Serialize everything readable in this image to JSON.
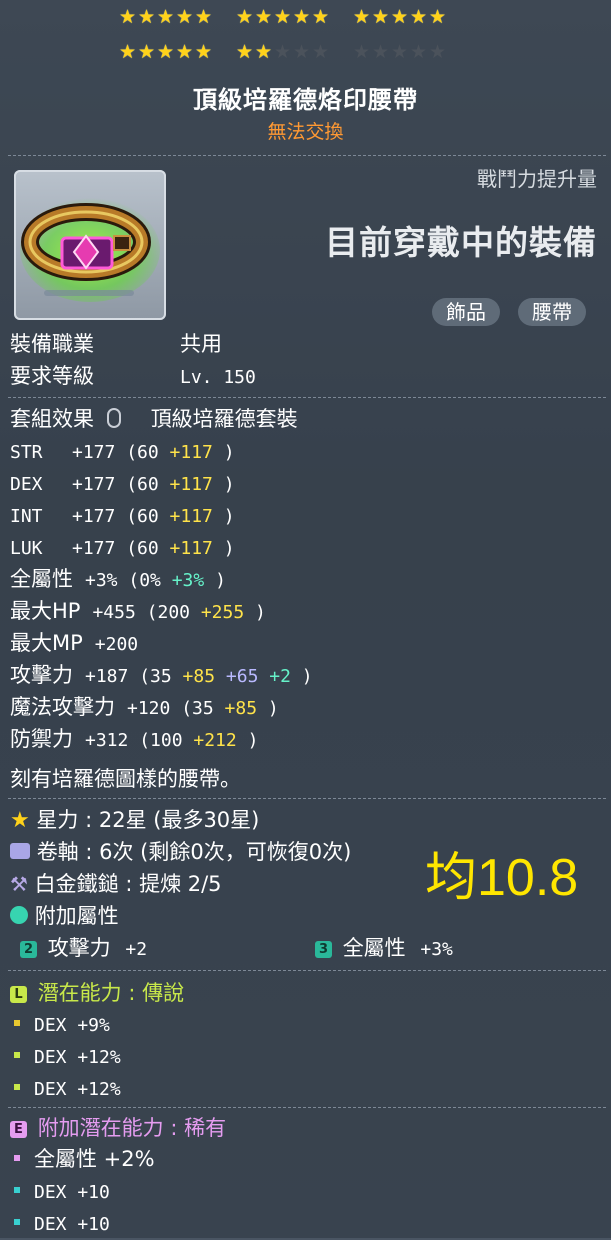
{
  "stars": {
    "filled": 22,
    "total": 30,
    "icon": "star-icon",
    "on_color": "#ffd21a",
    "off_color": "#4b525b"
  },
  "item": {
    "name": "頂級培羅德烙印腰帶",
    "trade_status": "無法交換",
    "trade_color": "#ff9933"
  },
  "compare": {
    "label": "戰鬥力提升量",
    "current_equipped": "目前穿戴中的裝備"
  },
  "tags": [
    "飾品",
    "腰帶"
  ],
  "requirements": [
    {
      "label": "裝備職業",
      "value": "共用"
    },
    {
      "label": "要求等級",
      "value": "Lv. 150"
    }
  ],
  "set_effect": {
    "label": "套組效果",
    "value": "頂級培羅德套裝"
  },
  "stats": [
    {
      "label": "STR",
      "total": "+177",
      "base": "(60 ",
      "b1": "+117",
      "close": ")"
    },
    {
      "label": "DEX",
      "total": "+177",
      "base": "(60 ",
      "b1": "+117",
      "close": ")"
    },
    {
      "label": "INT",
      "total": "+177",
      "base": "(60 ",
      "b1": "+117",
      "close": ")"
    },
    {
      "label": "LUK",
      "total": "+177",
      "base": "(60 ",
      "b1": "+117",
      "close": ")"
    },
    {
      "label": "全屬性",
      "total": "+3%",
      "base": "(0% ",
      "b1": "+3%",
      "close": ")"
    },
    {
      "label": "最大HP",
      "total": "+455",
      "base": "(200 ",
      "b1": "+255",
      "close": ")"
    },
    {
      "label": "最大MP",
      "total": "+200"
    },
    {
      "label": "攻擊力",
      "total": "+187",
      "base": "(35 ",
      "b1": "+85",
      "b2": "+65",
      "b3": "+2",
      "close": ")"
    },
    {
      "label": "魔法攻擊力",
      "total": "+120",
      "base": "(35 ",
      "b1": "+85",
      "close": ")"
    },
    {
      "label": "防禦力",
      "total": "+312",
      "base": "(100 ",
      "b1": "+212",
      "close": ")"
    }
  ],
  "description": "刻有培羅德圖樣的腰帶。",
  "enhance": {
    "starforce": {
      "label": "星力",
      "value": ": 22星 (最多30星)"
    },
    "scroll": {
      "label": "卷軸",
      "value": ": 6次 (剩餘0次，可恢復0次)"
    },
    "hammer": {
      "label": "白金鐵鎚",
      "value": ": 提煉 2/5"
    },
    "flame_label": "附加屬性",
    "flames": [
      {
        "tier": "2",
        "label": "攻擊力",
        "value": "+2"
      },
      {
        "tier": "3",
        "label": "全屬性",
        "value": "+3%"
      }
    ]
  },
  "avg_note": "均10.8",
  "potential": {
    "badge": "L",
    "label": "潛在能力",
    "grade": ": 傳說",
    "color": "#c8e84a",
    "lines": [
      "DEX  +9%",
      "DEX  +12%",
      "DEX  +12%"
    ],
    "bullet_colors": [
      "#e8c830",
      "#c8e84a",
      "#c8e84a"
    ]
  },
  "bonus_potential": {
    "badge": "E",
    "label": "附加潛在能力",
    "grade": ": 稀有",
    "color": "#e59cf0",
    "lines": [
      "全屬性  +2%",
      "DEX  +10",
      "DEX  +10"
    ],
    "bullet_colors": [
      "#e59cf0",
      "#39d0d0",
      "#39d0d0"
    ]
  }
}
